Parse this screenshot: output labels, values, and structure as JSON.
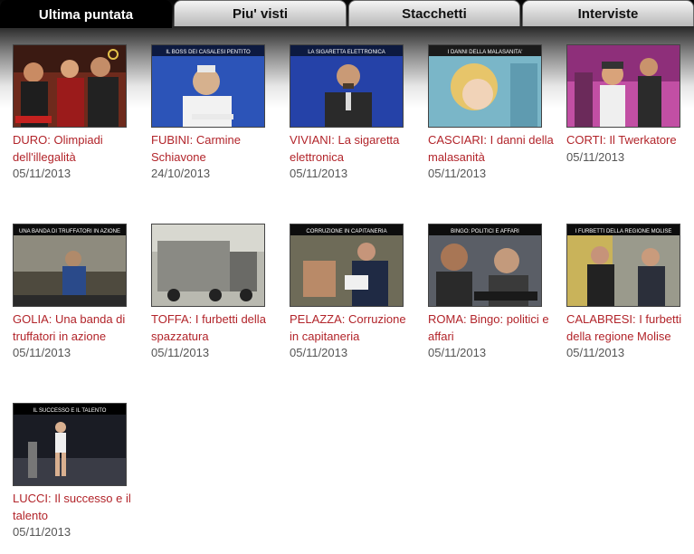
{
  "tabs": [
    {
      "label": "Ultima puntata",
      "active": true
    },
    {
      "label": "Piu' visti",
      "active": false
    },
    {
      "label": "Stacchetti",
      "active": false
    },
    {
      "label": "Interviste",
      "active": false
    }
  ],
  "colors": {
    "title": "#b2242a",
    "date": "#555555",
    "tab_active_bg": "#000000"
  },
  "videos": [
    {
      "title": "DURO: Olimpiadi dell'illegalità",
      "date": "05/11/2013",
      "thumb_caption": ""
    },
    {
      "title": "FUBINI: Carmine Schiavone",
      "date": "24/10/2013",
      "thumb_caption": "IL BOSS DEI CASALESI PENTITO"
    },
    {
      "title": "VIVIANI: La sigaretta elettronica",
      "date": "05/11/2013",
      "thumb_caption": "LA SIGARETTA ELETTRONICA"
    },
    {
      "title": "CASCIARI: I danni della malasanità",
      "date": "05/11/2013",
      "thumb_caption": "I DANNI DELLA MALASANITA'"
    },
    {
      "title": "CORTI: Il Twerkatore",
      "date": "05/11/2013",
      "thumb_caption": ""
    },
    {
      "title": "GOLIA: Una banda di truffatori in azione",
      "date": "05/11/2013",
      "thumb_caption": "UNA BANDA DI TRUFFATORI IN AZIONE"
    },
    {
      "title": "TOFFA: I furbetti della spazzatura",
      "date": "05/11/2013",
      "thumb_caption": ""
    },
    {
      "title": "PELAZZA: Corruzione in capitaneria",
      "date": "05/11/2013",
      "thumb_caption": "CORRUZIONE IN CAPITANERIA"
    },
    {
      "title": "ROMA: Bingo: politici e affari",
      "date": "05/11/2013",
      "thumb_caption": "BINGO: POLITICI E AFFARI"
    },
    {
      "title": "CALABRESI: I furbetti della regione Molise",
      "date": "05/11/2013",
      "thumb_caption": "I FURBETTI DELLA REGIONE MOLISE"
    },
    {
      "title": "LUCCI: Il successo e il talento",
      "date": "05/11/2013",
      "thumb_caption": "IL SUCCESSO E IL TALENTO"
    }
  ]
}
